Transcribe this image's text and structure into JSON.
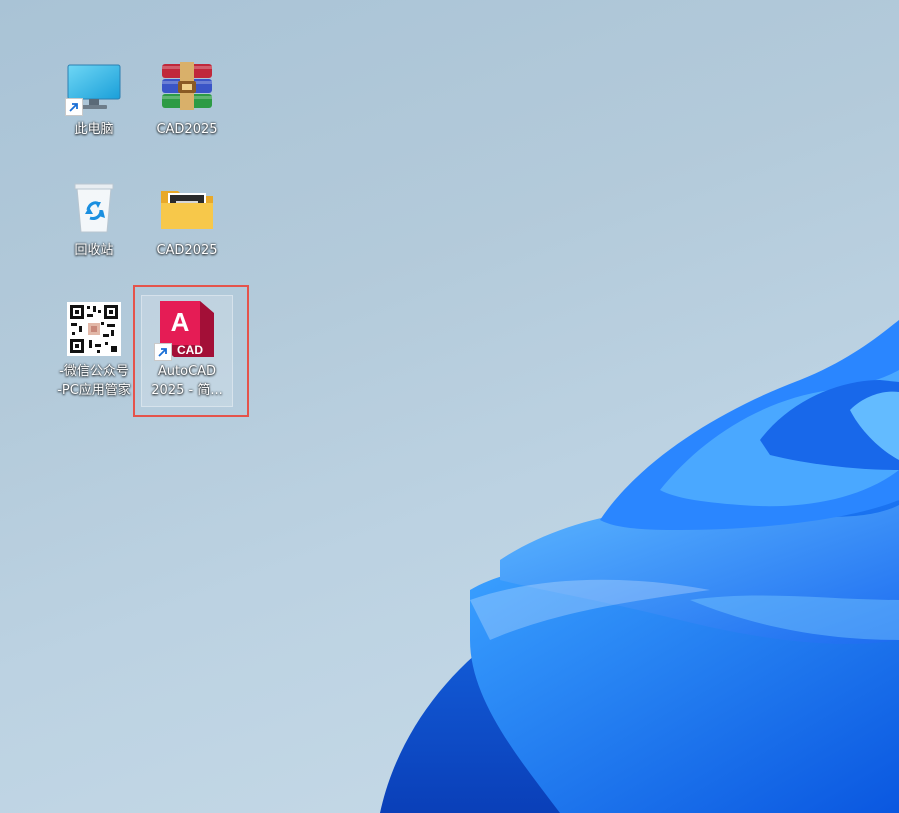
{
  "desktop": {
    "icons": [
      {
        "label": "此电脑",
        "icon": "monitor-icon"
      },
      {
        "label": "CAD2025",
        "icon": "winrar-archive-icon"
      },
      {
        "label": "回收站",
        "icon": "recycle-bin-icon"
      },
      {
        "label": "CAD2025",
        "icon": "folder-icon"
      },
      {
        "label_line1": "-微信公众号",
        "label_line2": "-PC应用管家",
        "icon": "qr-code-icon"
      },
      {
        "label_line1": "AutoCAD",
        "label_line2": "2025 - 简...",
        "icon": "autocad-icon",
        "badge": "CAD",
        "letter": "A"
      }
    ]
  },
  "colors": {
    "selection_border": "#e5534b",
    "autocad_red": "#d9174a",
    "folder_yellow": "#f5c542"
  }
}
